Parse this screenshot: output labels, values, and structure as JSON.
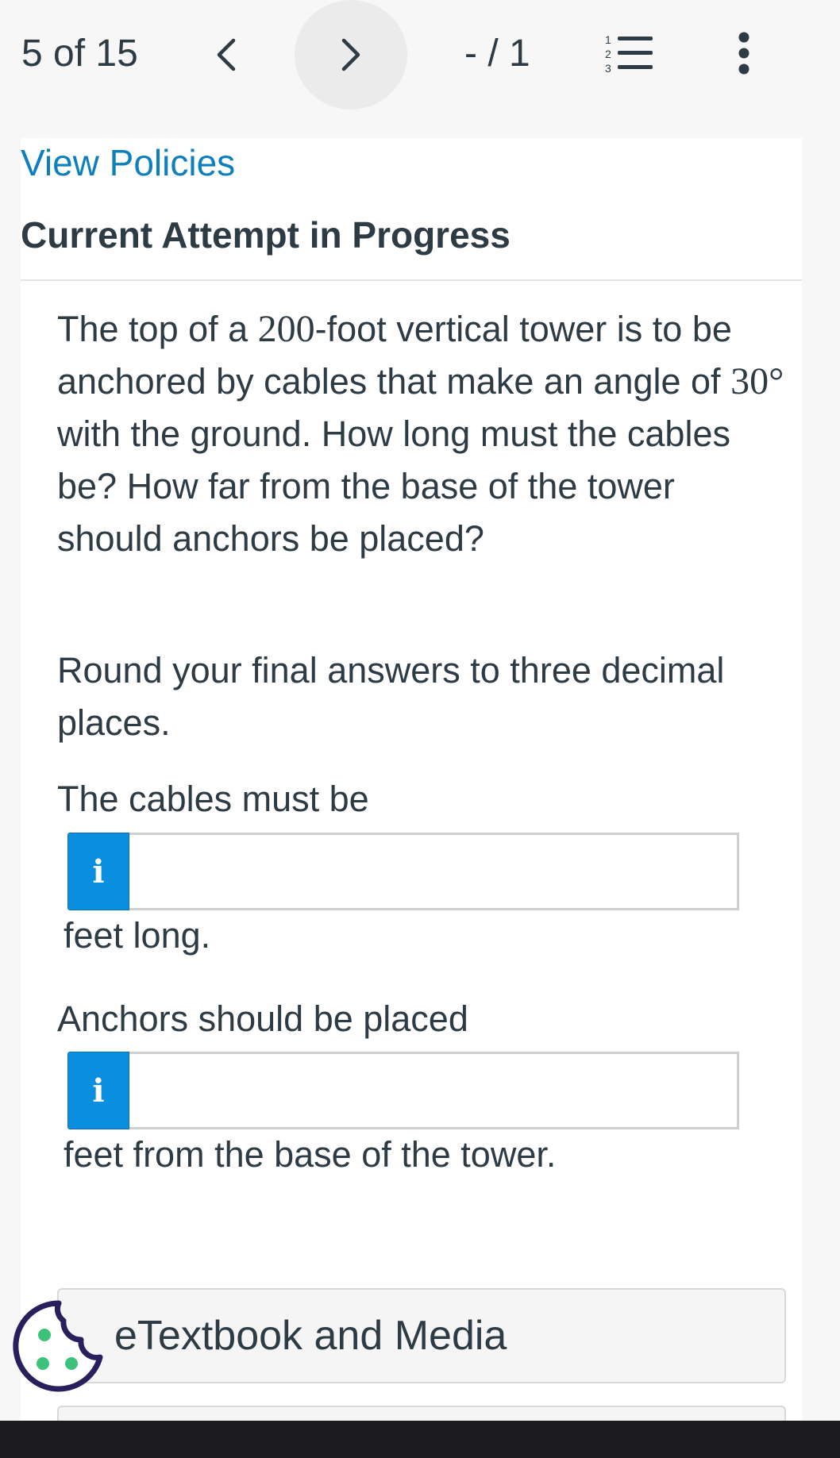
{
  "toolbar": {
    "counter": "5 of 15",
    "prev_icon": "chevron-left-icon",
    "next_icon": "chevron-right-icon",
    "score": "- / 1",
    "list_icon": "numbered-list-icon",
    "more_icon": "more-vertical-icon"
  },
  "header": {
    "view_policies": "View Policies",
    "attempt_heading": "Current Attempt in Progress"
  },
  "question": {
    "text_1": "The top of a ",
    "height_value": "200",
    "text_2": "-foot vertical tower is to be anchored by cables that make an angle of ",
    "angle_value": "30°",
    "text_3": " with the ground. How long must the cables be? How far from the base of the tower should anchors be placed?",
    "instruction": "Round your final answers to three decimal places."
  },
  "answers": {
    "cable_prompt": "The cables must be",
    "cable_value": "",
    "cable_unit": "feet long.",
    "anchor_prompt": "Anchors should be placed",
    "anchor_value": "",
    "anchor_unit": "feet from the base of the tower.",
    "info_label": "i"
  },
  "resources": {
    "etextbook_label": "eTextbook and Media"
  },
  "colors": {
    "link": "#0d7fbf",
    "info_tag": "#0a8ee0",
    "text": "#2d3b45",
    "cookie_outline": "#2a1f5c",
    "cookie_dots": "#3ec27a"
  },
  "icons": {
    "info": "info-icon",
    "cookie": "cookie-icon"
  }
}
